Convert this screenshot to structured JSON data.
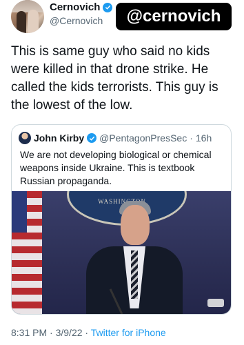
{
  "author": {
    "display_name": "Cernovich",
    "handle": "@Cernovich",
    "verified": true,
    "avatar_icon": "profile-photo"
  },
  "sticker": {
    "text": "@cernovich"
  },
  "tweet": {
    "text": "This is same guy who said no kids were killed in that drone strike. He called the kids terrorists. This guy is the lowest of the low."
  },
  "quoted_tweet": {
    "author_name": "John Kirby",
    "handle": "@PentagonPresSec",
    "separator": "·",
    "age": "16h",
    "text": "We are not developing biological or chemical weapons inside Ukraine. This is textbook Russian propaganda.",
    "media_overlay_text": "WASHINGTON"
  },
  "meta": {
    "time": "8:31 PM",
    "separator": "·",
    "date": "3/9/22",
    "source": "Twitter for iPhone"
  },
  "colors": {
    "accent": "#1d9bf0",
    "secondary_text": "#536471",
    "primary_text": "#0f1419",
    "border": "#cfd9de"
  }
}
